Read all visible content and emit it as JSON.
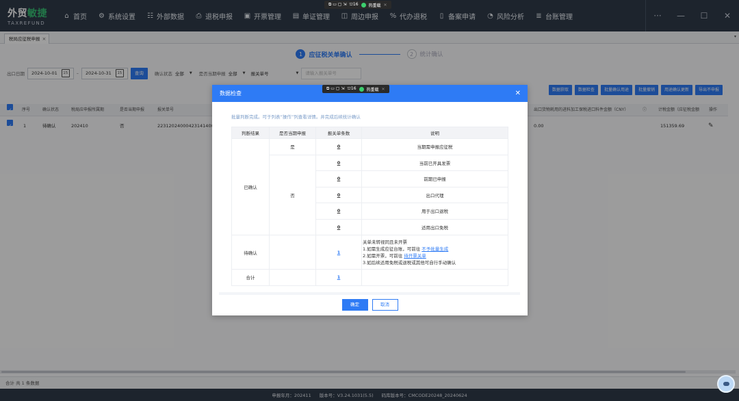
{
  "app": {
    "logo_cn_a": "外贸",
    "logo_cn_b": "敏捷",
    "logo_en": "TAXREFUND"
  },
  "nav": [
    {
      "label": "首页",
      "icon": "home-icon",
      "glyph": "⌂"
    },
    {
      "label": "系统设置",
      "icon": "settings-icon",
      "glyph": "⚙"
    },
    {
      "label": "外部数据",
      "icon": "external-data-icon",
      "glyph": "☷"
    },
    {
      "label": "退税申报",
      "icon": "tax-refund-icon",
      "glyph": "⎙"
    },
    {
      "label": "开票管理",
      "icon": "invoice-icon",
      "glyph": "▣"
    },
    {
      "label": "单证管理",
      "icon": "document-icon",
      "glyph": "▤"
    },
    {
      "label": "周边申报",
      "icon": "declare-icon",
      "glyph": "◫"
    },
    {
      "label": "代办退税",
      "icon": "agency-icon",
      "glyph": "%"
    },
    {
      "label": "备案申请",
      "icon": "filing-icon",
      "glyph": "▯"
    },
    {
      "label": "风险分析",
      "icon": "risk-icon",
      "glyph": "◔"
    },
    {
      "label": "台账管理",
      "icon": "ledger-icon",
      "glyph": "≣"
    }
  ],
  "window_controls": {
    "more": "···",
    "min": "—",
    "max": "☐",
    "close": "✕"
  },
  "float_toolbar": {
    "count": "16",
    "label": "热重载"
  },
  "tab": {
    "label": "税局应征税申报"
  },
  "stepper": {
    "step1_num": "1",
    "step1_label": "应征税关单确认",
    "step2_num": "2",
    "step2_label": "统计确认"
  },
  "filters": {
    "export_date_label": "出口日期",
    "date_from": "2024-10-01",
    "date_sep": "–",
    "date_to": "2024-10-31",
    "cal_icon": "15",
    "query_button": "查询",
    "confirm_status_label": "确认状态",
    "confirm_status_value": "全部",
    "current_period_label": "是否当期申报",
    "current_period_value": "全部",
    "field_select": "报关单号",
    "search_placeholder": "请输入报关单号"
  },
  "actions": [
    "数据获取",
    "数据检查",
    "批量确认用途",
    "批量撤销",
    "用途确认更新",
    "导出不申报"
  ],
  "table": {
    "headers": {
      "seq": "序号",
      "status": "确认状态",
      "period": "税局应申报所属期",
      "current": "是否当期申报",
      "customs_no": "报关单号",
      "material_amount": "出口货物耗用的进料加工保税进口料件金额（CNY）",
      "tax_amount": "计税金额（应征税金额",
      "op": "操作"
    },
    "rows": [
      {
        "seq": "1",
        "status": "待确认",
        "period": "202410",
        "current": "否",
        "customs_no": "22312024000423141400",
        "material_amount": "0.00",
        "tax_amount": "151359.69"
      }
    ]
  },
  "footer": {
    "count_text": "合计  共 1 条数据",
    "declare_period": "申报年月：202411",
    "version": "版本号：V3.24.1031(5.5)",
    "code_version": "码库版本号：CMCODE20248_20240624"
  },
  "modal": {
    "title": "数据检查",
    "tip": "批量判断完成。可于列表“操作”列查看详情。并完成后续统计确认",
    "headers": [
      "判断结果",
      "是否当期申报",
      "报关单条数",
      "说明"
    ],
    "rows": {
      "confirmed_label": "已确认",
      "yes_label": "是",
      "no_label": "否",
      "yes_count": "0",
      "yes_desc": "当期需申报应征税",
      "no_items": [
        {
          "count": "0",
          "desc": "当前已开具发票"
        },
        {
          "count": "0",
          "desc": "前期已申报"
        },
        {
          "count": "0",
          "desc": "出口代理"
        },
        {
          "count": "0",
          "desc": "用于出口退税"
        },
        {
          "count": "0",
          "desc": "适用出口免税"
        }
      ],
      "pending_label": "待确认",
      "pending_count": "1",
      "pending_desc": {
        "line1": "关单未转视同且未开票",
        "line2a": "1.如需生成应征台账，可前往",
        "link1": "不予批量生成",
        "line3a": "2.如需开票，可前往",
        "link2": "待开票关单",
        "line4": "3.如后续适用免税或退税或其他可自行手动确认"
      },
      "total_label": "合计",
      "total_count": "1"
    },
    "ok_button": "确定",
    "cancel_button": "取消"
  }
}
